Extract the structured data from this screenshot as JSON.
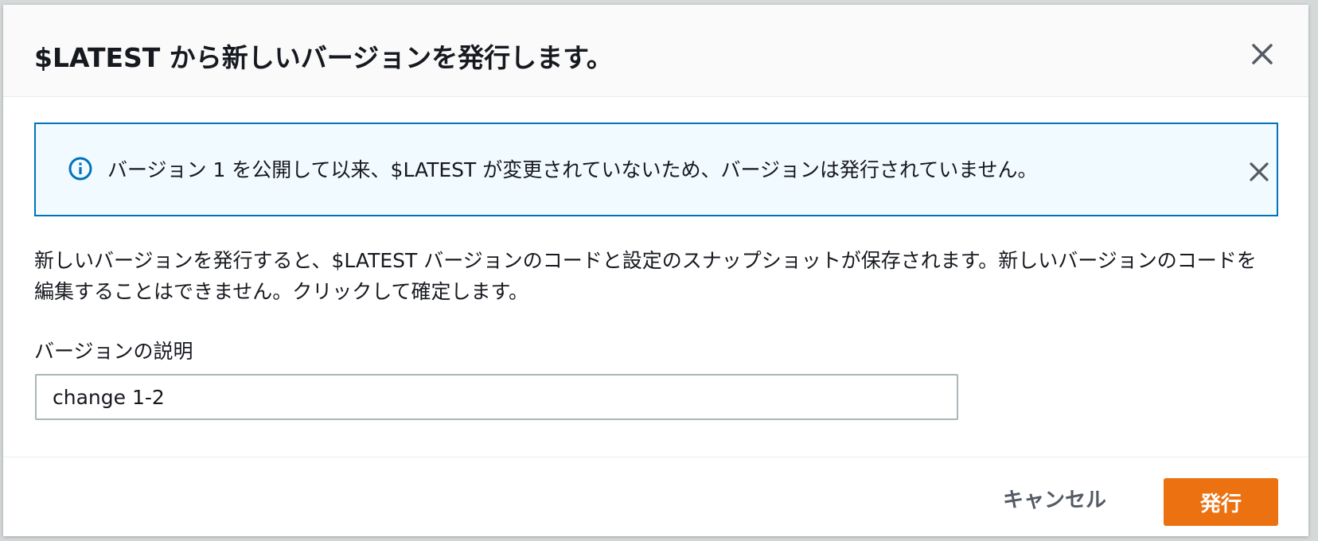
{
  "modal": {
    "title": "$LATEST から新しいバージョンを発行します。",
    "close_icon": "close-icon"
  },
  "alert": {
    "icon": "info-icon",
    "message": "バージョン 1 を公開して以来、$LATEST が変更されていないため、バージョンは発行されていません。",
    "dismiss_icon": "close-icon"
  },
  "body": {
    "description": "新しいバージョンを発行すると、$LATEST バージョンのコードと設定のスナップショットが保存されます。新しいバージョンのコードを編集することはできません。クリックして確定します。"
  },
  "form": {
    "version_description": {
      "label": "バージョンの説明",
      "value": "change 1-2"
    }
  },
  "footer": {
    "cancel_label": "キャンセル",
    "publish_label": "発行"
  },
  "colors": {
    "primary": "#ec7211",
    "info_border": "#0073bb",
    "info_background": "#f1faff"
  }
}
